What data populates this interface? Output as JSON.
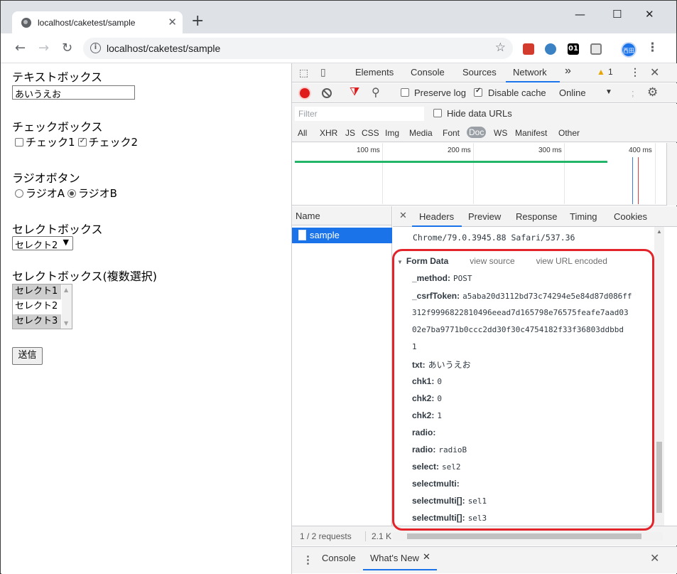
{
  "browser": {
    "tab_title": "localhost/caketest/sample",
    "tab_close": "✕",
    "new_tab": "+",
    "url": "localhost/caketest/sample",
    "profile_initials": "西田",
    "ext_01": "01",
    "minimize": "—",
    "maximize": "☐",
    "close": "✕"
  },
  "page": {
    "text_label": "テキストボックス",
    "text_value": "あいうえお",
    "checkbox_label": "チェックボックス",
    "check1": "チェック1",
    "check2": "チェック2",
    "radio_label": "ラジオボタン",
    "radioA": "ラジオA",
    "radioB": "ラジオB",
    "select_label": "セレクトボックス",
    "select_value": "セレクト2",
    "multi_label": "セレクトボックス(複数選択)",
    "multi_options": [
      "セレクト1",
      "セレクト2",
      "セレクト3"
    ],
    "submit": "送信"
  },
  "devtools": {
    "tabs": [
      "Elements",
      "Console",
      "Sources",
      "Network"
    ],
    "more": "»",
    "warning_count": "1",
    "preserve_log": "Preserve log",
    "disable_cache": "Disable cache",
    "throttle": "Online",
    "filter_placeholder": "Filter",
    "hide_data_urls": "Hide data URLs",
    "types": [
      "All",
      "XHR",
      "JS",
      "CSS",
      "Img",
      "Media",
      "Font",
      "Doc",
      "WS",
      "Manifest",
      "Other"
    ],
    "ticks": [
      "100 ms",
      "200 ms",
      "300 ms",
      "400 ms"
    ],
    "name_header": "Name",
    "request_name": "sample",
    "detail_tabs": [
      "Headers",
      "Preview",
      "Response",
      "Timing",
      "Cookies"
    ],
    "ua_line": "Chrome/79.0.3945.88 Safari/537.36",
    "form_title": "Form Data",
    "view_source": "view source",
    "view_url_encoded": "view URL encoded",
    "form": {
      "method_key": "_method:",
      "method_val": "POST",
      "csrf_key": "_csrfToken:",
      "csrf_val1": "a5aba20d3112bd73c74294e5e84d87d086ff",
      "csrf_val2": "312f9996822810496eead7d165798e76575feafe7aad03",
      "csrf_val3": "02e7ba9771b0ccc2dd30f30c4754182f33f36803ddbbd",
      "csrf_val4": "1",
      "txt_key": "txt:",
      "txt_val": "あいうえお",
      "chk1_key": "chk1:",
      "chk1_val": "0",
      "chk2a_key": "chk2:",
      "chk2a_val": "0",
      "chk2b_key": "chk2:",
      "chk2b_val": "1",
      "radio1_key": "radio:",
      "radio2_key": "radio:",
      "radio2_val": "radioB",
      "select_key": "select:",
      "select_val": "sel2",
      "selmulti_key": "selectmulti:",
      "selmulti1_key": "selectmulti[]:",
      "selmulti1_val": "sel1",
      "selmulti2_key": "selectmulti[]:",
      "selmulti2_val": "sel3"
    },
    "status_requests": "1 / 2 requests",
    "status_size": "2.1 K",
    "drawer_console": "Console",
    "drawer_whatsnew": "What's New",
    "colors": {
      "accent": "#1a73e8",
      "record": "#e01b1b",
      "highlight": "#e3242b",
      "waterfall_green": "#23b569"
    }
  }
}
